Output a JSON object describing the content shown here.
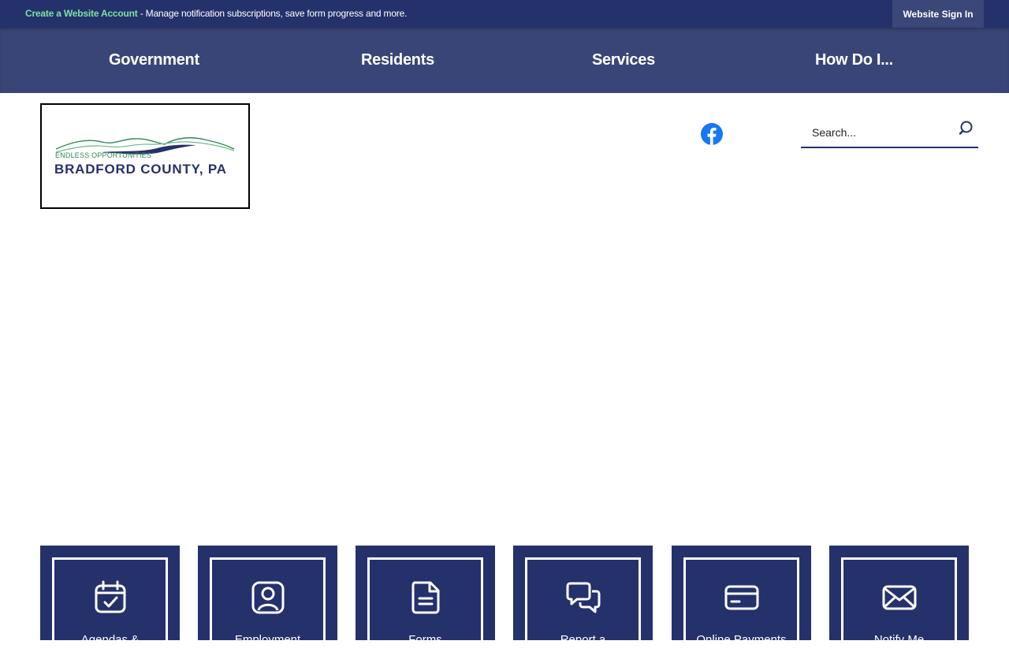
{
  "topbar": {
    "create_link": "Create a Website Account",
    "message": " - Manage notification subscriptions, save form progress and more.",
    "signin_label": "Website Sign In"
  },
  "nav": {
    "items": [
      {
        "label": "Government"
      },
      {
        "label": "Residents"
      },
      {
        "label": "Services"
      },
      {
        "label": "How Do I..."
      }
    ]
  },
  "logo": {
    "tagline": "ENDLESS OPPORTUNITIES",
    "name": "BRADFORD COUNTY, PA"
  },
  "social": {
    "icon": "facebook-icon",
    "color": "#1877f2"
  },
  "search": {
    "placeholder": "Search...",
    "value": ""
  },
  "tiles": [
    {
      "label": "Agendas &",
      "icon": "calendar-check-icon"
    },
    {
      "label": "Employment",
      "icon": "user-badge-icon"
    },
    {
      "label": "Forms",
      "icon": "document-icon"
    },
    {
      "label": "Report a",
      "icon": "chat-bubbles-icon"
    },
    {
      "label": "Online Payments",
      "icon": "credit-card-icon"
    },
    {
      "label": "Notify Me",
      "icon": "envelope-icon"
    }
  ],
  "colors": {
    "brand_navy": "#25316b",
    "nav_bg": "#3a4577",
    "accent_green": "#7fe0a6"
  }
}
